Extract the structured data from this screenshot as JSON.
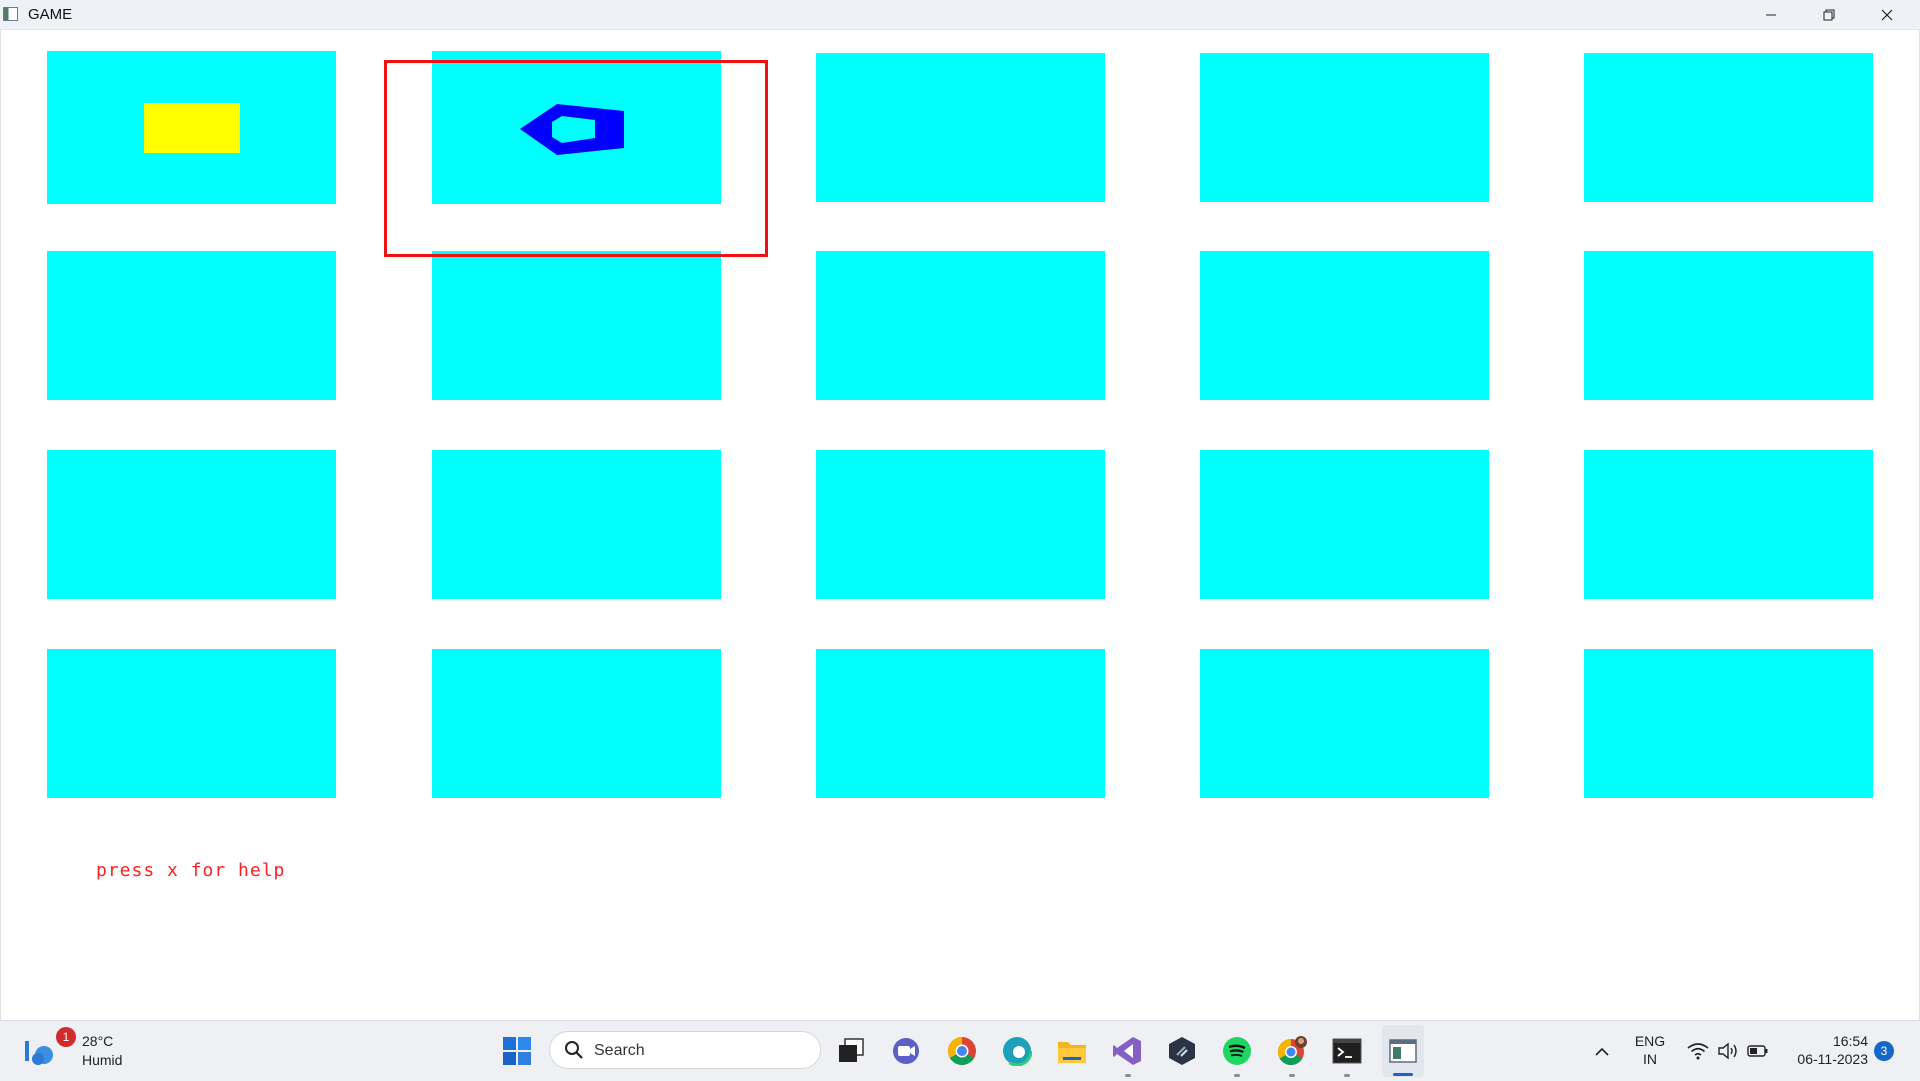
{
  "window": {
    "title": "GAME",
    "buttons": {
      "minimize": "minimize-icon",
      "maximize": "restore-icon",
      "close": "close-icon"
    }
  },
  "game": {
    "tile_color": "#00ffff",
    "selector_color": "#ee1111",
    "selected_tile": {
      "row": 1,
      "col": 2
    },
    "revealed": [
      {
        "row": 1,
        "col": 1,
        "shape": "rectangle",
        "color": "#ffff00"
      },
      {
        "row": 1,
        "col": 2,
        "shape": "pentagon-outline",
        "color": "#0000ff"
      }
    ],
    "help_text": "press x for help"
  },
  "taskbar": {
    "weather": {
      "temperature": "28°C",
      "condition": "Humid",
      "badge": "1"
    },
    "search_placeholder": "Search",
    "pinned_icons": [
      "windows-start-icon",
      "task-view-icon",
      "teams-meet-icon",
      "chrome-icon",
      "edge-icon",
      "file-explorer-icon",
      "visual-studio-icon",
      "terminal-app-icon",
      "spotify-icon",
      "chrome-profile-icon",
      "command-prompt-icon",
      "game-app-icon"
    ],
    "tray": {
      "language": "ENG",
      "region": "IN",
      "time": "16:54",
      "date": "06-11-2023",
      "notifications": "3"
    }
  }
}
